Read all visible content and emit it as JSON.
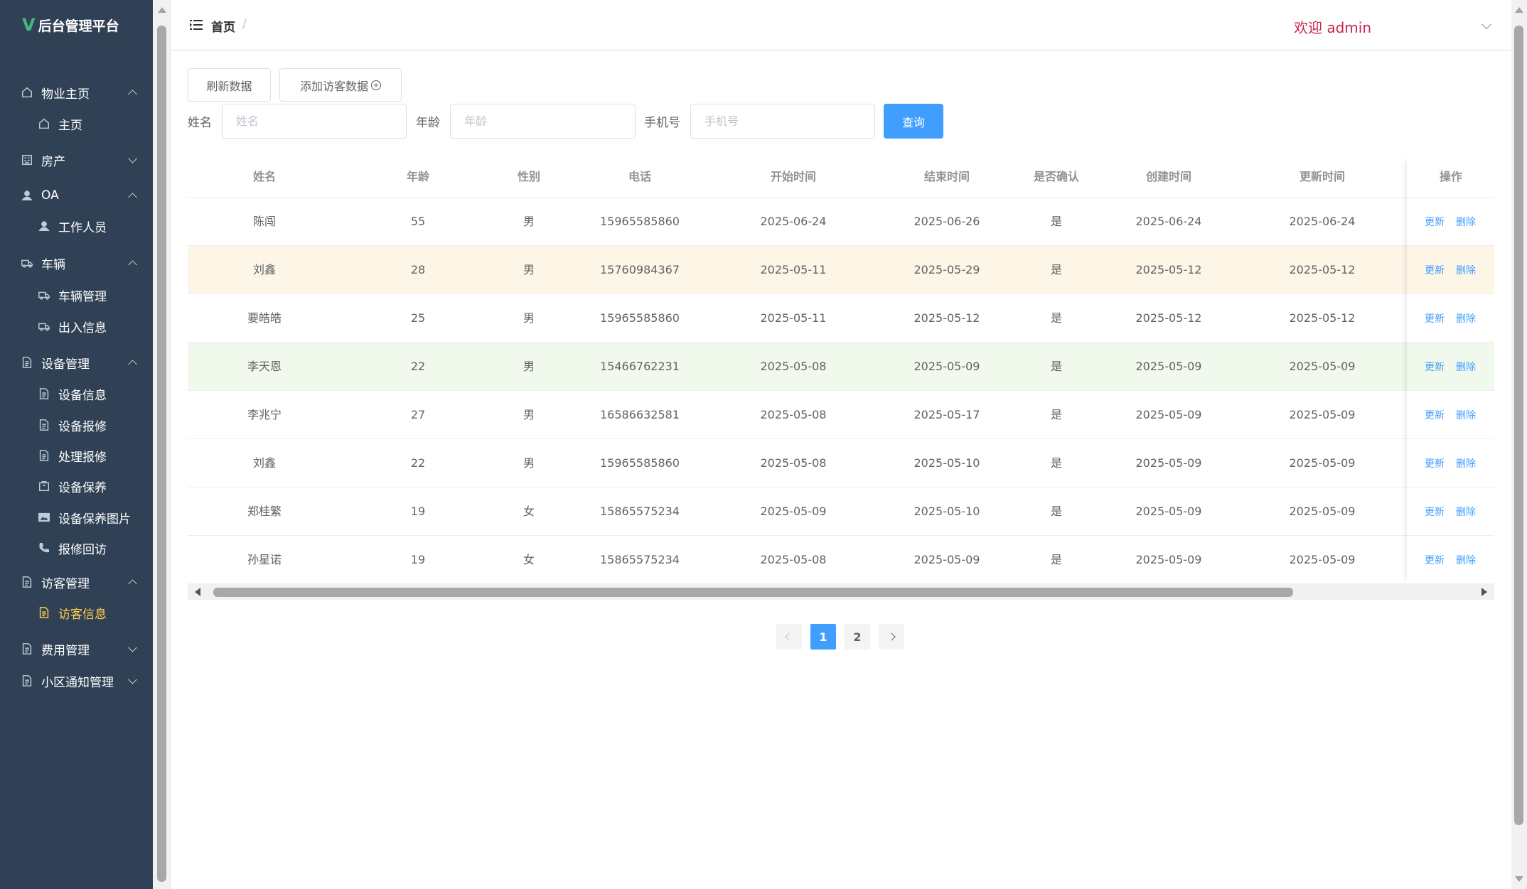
{
  "app": {
    "title": "后台管理平台",
    "logo_glyph": "V",
    "logo_color": "#41b883"
  },
  "sidebar": {
    "bg_color": "#304156",
    "active_color": "#ffd04b",
    "items": [
      {
        "label": "物业主页",
        "icon": "home-icon",
        "level": "top",
        "expanded": true
      },
      {
        "label": "主页",
        "icon": "home-icon",
        "level": "sub"
      },
      {
        "label": "房产",
        "icon": "building-icon",
        "level": "top",
        "expanded": false
      },
      {
        "label": "OA",
        "icon": "user-icon",
        "level": "top",
        "expanded": true
      },
      {
        "label": "工作人员",
        "icon": "user-icon",
        "level": "sub"
      },
      {
        "label": "车辆",
        "icon": "truck-icon",
        "level": "top",
        "expanded": true
      },
      {
        "label": "车辆管理",
        "icon": "truck-icon",
        "level": "sub"
      },
      {
        "label": "出入信息",
        "icon": "truck-icon",
        "level": "sub"
      },
      {
        "label": "设备管理",
        "icon": "document-icon",
        "level": "top",
        "expanded": true
      },
      {
        "label": "设备信息",
        "icon": "document-icon",
        "level": "sub"
      },
      {
        "label": "设备报修",
        "icon": "document-icon",
        "level": "sub"
      },
      {
        "label": "处理报修",
        "icon": "document-icon",
        "level": "sub"
      },
      {
        "label": "设备保养",
        "icon": "box-icon",
        "level": "sub"
      },
      {
        "label": "设备保养图片",
        "icon": "picture-icon",
        "level": "sub"
      },
      {
        "label": "报修回访",
        "icon": "phone-icon",
        "level": "sub"
      },
      {
        "label": "访客管理",
        "icon": "document-icon",
        "level": "top",
        "expanded": true
      },
      {
        "label": "访客信息",
        "icon": "document-icon",
        "level": "sub",
        "active": true
      },
      {
        "label": "费用管理",
        "icon": "document-icon",
        "level": "top",
        "expanded": false
      },
      {
        "label": "小区通知管理",
        "icon": "document-icon",
        "level": "top",
        "expanded": false
      }
    ]
  },
  "header": {
    "breadcrumb": "首页",
    "breadcrumb_sep": "/",
    "welcome": "欢迎 admin",
    "welcome_color": "#c7254e"
  },
  "toolbar": {
    "refresh_label": "刷新数据",
    "add_label": "添加访客数据",
    "add_icon": "⊕"
  },
  "filters": {
    "name_label": "姓名",
    "name_placeholder": "姓名",
    "age_label": "年龄",
    "age_placeholder": "年龄",
    "phone_label": "手机号",
    "phone_placeholder": "手机号",
    "query_label": "查询",
    "query_color": "#409eff"
  },
  "table": {
    "columns": [
      "姓名",
      "年龄",
      "性别",
      "电话",
      "开始时间",
      "结束时间",
      "是否确认",
      "创建时间",
      "更新时间",
      "操作"
    ],
    "update_label": "更新",
    "delete_label": "删除",
    "rows": [
      {
        "name": "陈闯",
        "age": "55",
        "gender": "男",
        "phone": "15965585860",
        "start": "2025-06-24",
        "end": "2025-06-26",
        "confirmed": "是",
        "created": "2025-06-24",
        "updated": "2025-06-24",
        "highlight": ""
      },
      {
        "name": "刘鑫",
        "age": "28",
        "gender": "男",
        "phone": "15760984367",
        "start": "2025-05-11",
        "end": "2025-05-29",
        "confirmed": "是",
        "created": "2025-05-12",
        "updated": "2025-05-12",
        "highlight": "hl1"
      },
      {
        "name": "要皓皓",
        "age": "25",
        "gender": "男",
        "phone": "15965585860",
        "start": "2025-05-11",
        "end": "2025-05-12",
        "confirmed": "是",
        "created": "2025-05-12",
        "updated": "2025-05-12",
        "highlight": ""
      },
      {
        "name": "李天恩",
        "age": "22",
        "gender": "男",
        "phone": "15466762231",
        "start": "2025-05-08",
        "end": "2025-05-09",
        "confirmed": "是",
        "created": "2025-05-09",
        "updated": "2025-05-09",
        "highlight": "hl2"
      },
      {
        "name": "李兆宁",
        "age": "27",
        "gender": "男",
        "phone": "16586632581",
        "start": "2025-05-08",
        "end": "2025-05-17",
        "confirmed": "是",
        "created": "2025-05-09",
        "updated": "2025-05-09",
        "highlight": ""
      },
      {
        "name": "刘鑫",
        "age": "22",
        "gender": "男",
        "phone": "15965585860",
        "start": "2025-05-08",
        "end": "2025-05-10",
        "confirmed": "是",
        "created": "2025-05-09",
        "updated": "2025-05-09",
        "highlight": ""
      },
      {
        "name": "郑桂繁",
        "age": "19",
        "gender": "女",
        "phone": "15865575234",
        "start": "2025-05-09",
        "end": "2025-05-10",
        "confirmed": "是",
        "created": "2025-05-09",
        "updated": "2025-05-09",
        "highlight": ""
      },
      {
        "name": "孙星诺",
        "age": "19",
        "gender": "女",
        "phone": "15865575234",
        "start": "2025-05-08",
        "end": "2025-05-09",
        "confirmed": "是",
        "created": "2025-05-09",
        "updated": "2025-05-09",
        "highlight": ""
      }
    ]
  },
  "pagination": {
    "pages": [
      "1",
      "2"
    ],
    "current": "1",
    "active_color": "#409eff"
  }
}
